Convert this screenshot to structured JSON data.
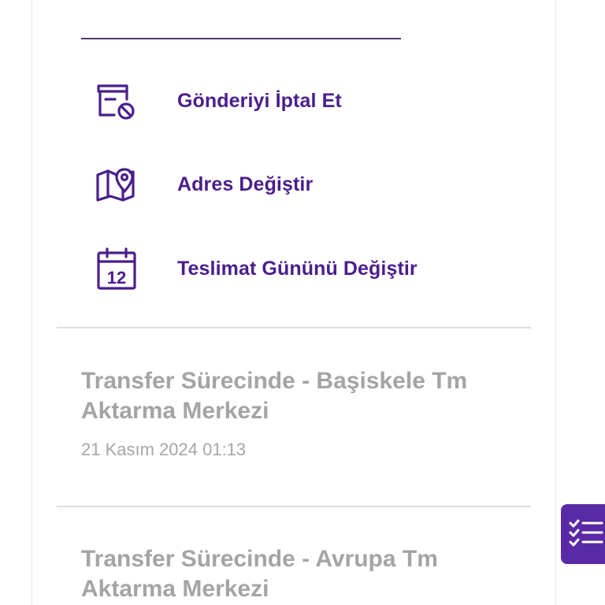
{
  "colors": {
    "accent": "#4a1e8c",
    "fab_background": "#5a2aa6",
    "muted_text": "#a4a4a4",
    "divider": "#dedede"
  },
  "actions": [
    {
      "label": "Gönderiyi İptal Et",
      "icon": "cancel-shipment-icon"
    },
    {
      "label": "Adres Değiştir",
      "icon": "map-pin-icon"
    },
    {
      "label": "Teslimat Gününü Değiştir",
      "icon": "calendar-icon",
      "icon_text": "12"
    }
  ],
  "tracking_events": [
    {
      "title": "Transfer Sürecinde - Başiskele Tm Aktarma Merkezi",
      "date": "21 Kasım 2024 01:13"
    },
    {
      "title": "Transfer Sürecinde - Avrupa Tm Aktarma Merkezi",
      "date": ""
    }
  ],
  "fab": {
    "icon": "checklist-icon"
  }
}
